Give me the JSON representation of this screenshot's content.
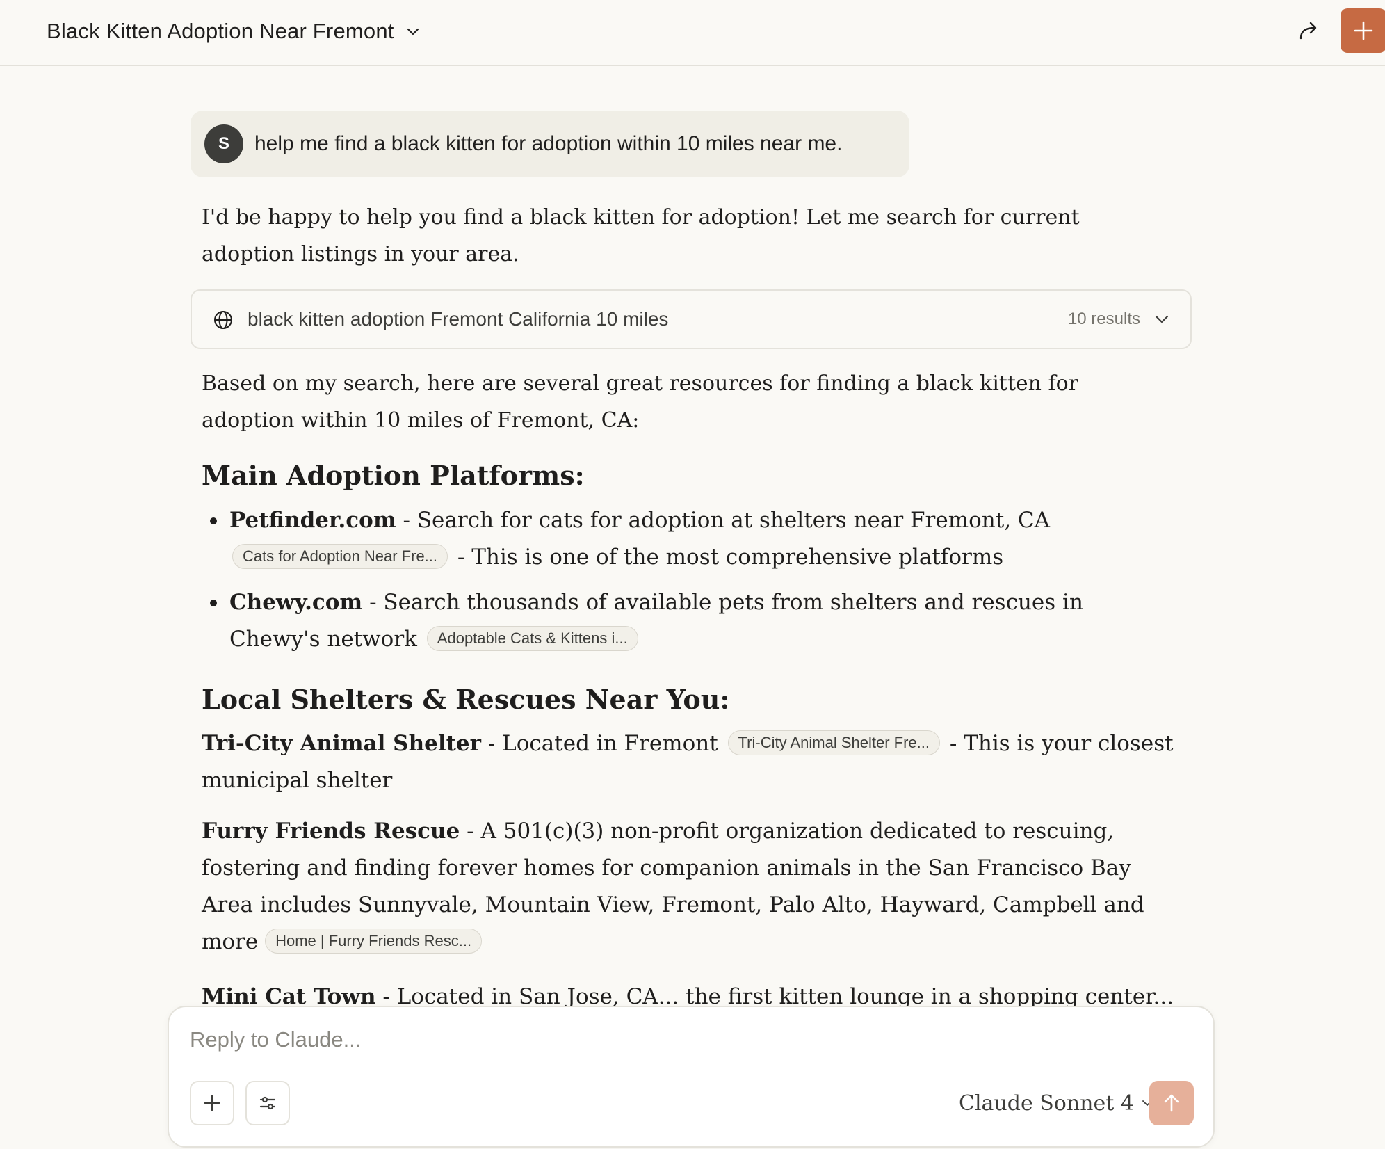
{
  "header": {
    "title": "Black Kitten Adoption Near Fremont",
    "share_icon": "share-icon",
    "new_chat_icon": "plus-icon",
    "accent_color": "#c66a43"
  },
  "user_message": {
    "avatar_initial": "S",
    "text": "help me find a black kitten for adoption within 10 miles near me."
  },
  "assistant": {
    "intro": "I'd be happy to help you find a black kitten for adoption! Let me search for current adoption listings in your area.",
    "search": {
      "query": "black kitten adoption Fremont California 10 miles",
      "results": "10 results"
    },
    "summary": "Based on my search, here are several great resources for finding a black kitten for adoption within 10 miles of Fremont, CA:",
    "section1_heading": "Main Adoption Platforms:",
    "platforms": [
      {
        "name": "Petfinder.com",
        "desc": " - Search for cats for adoption at shelters near Fremont, CA ",
        "chip": "Cats for Adoption Near Fre...",
        "tail": " - This is one of the most comprehensive platforms"
      },
      {
        "name": "Chewy.com",
        "desc": " - Search thousands of available pets from shelters and rescues in Chewy's network ",
        "chip": "Adoptable Cats & Kittens i...",
        "tail": ""
      }
    ],
    "section2_heading": "Local Shelters & Rescues Near You:",
    "shelters": [
      {
        "name": "Tri-City Animal Shelter",
        "desc": " - Located in Fremont ",
        "chip": "Tri-City Animal Shelter Fre...",
        "tail": " - This is your closest municipal shelter"
      },
      {
        "name": "Furry Friends Rescue",
        "desc": " - A 501(c)(3) non-profit organization dedicated to rescuing, fostering and finding forever homes for companion animals in the San Francisco Bay Area includes Sunnyvale, Mountain View, Fremont, Palo Alto, Hayward, Campbell and more ",
        "chip": "Home | Furry Friends Resc...",
        "tail": ""
      },
      {
        "name": "Mini Cat Town",
        "desc": " - Located in San Jose, CA... the first kitten lounge in a shopping center...",
        "chip": "",
        "tail": ""
      }
    ]
  },
  "composer": {
    "placeholder": "Reply to Claude...",
    "model": "Claude Sonnet 4",
    "send_color": "#e6b09a"
  }
}
